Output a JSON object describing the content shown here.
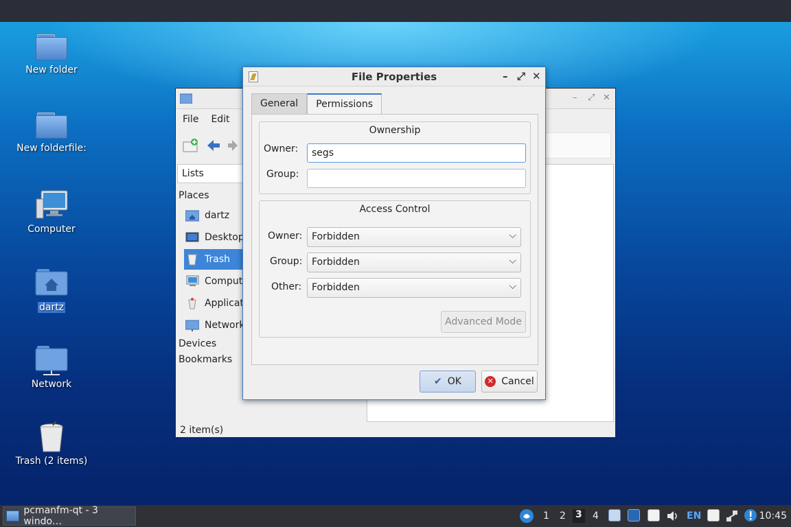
{
  "desktop": {
    "icons": [
      {
        "label": "New folder"
      },
      {
        "label": "New folderfile:"
      },
      {
        "label": "Computer"
      },
      {
        "label": "dartz"
      },
      {
        "label": "Network"
      },
      {
        "label": "Trash (2 items)"
      }
    ]
  },
  "file_manager": {
    "menu": [
      "File",
      "Edit"
    ],
    "lists_label": "Lists",
    "places_header": "Places",
    "places": [
      "dartz",
      "Desktop",
      "Trash",
      "Computer",
      "Applications",
      "Network"
    ],
    "devices_header": "Devices",
    "bookmarks_header": "Bookmarks",
    "status": "2 item(s)"
  },
  "dialog": {
    "title": "File Properties",
    "tabs": [
      "General",
      "Permissions"
    ],
    "active_tab": "Permissions",
    "ownership": {
      "title": "Ownership",
      "owner_label": "Owner:",
      "owner_value": "segs",
      "group_label": "Group:",
      "group_value": ""
    },
    "access": {
      "title": "Access Control",
      "owner_label": "Owner:",
      "owner_value": "Forbidden",
      "group_label": "Group:",
      "group_value": "Forbidden",
      "other_label": "Other:",
      "other_value": "Forbidden",
      "advanced_label": "Advanced Mode"
    },
    "ok_label": "OK",
    "cancel_label": "Cancel"
  },
  "taskbar": {
    "task_label": "pcmanfm-qt - 3 windo…",
    "workspaces": [
      "1",
      "2",
      "3",
      "4"
    ],
    "active_workspace": "3",
    "keyboard_layout": "EN",
    "clock": "10:45"
  },
  "colors": {
    "accent": "#3c78c8",
    "selection": "#3d85d8",
    "taskbar": "#2f3137"
  }
}
